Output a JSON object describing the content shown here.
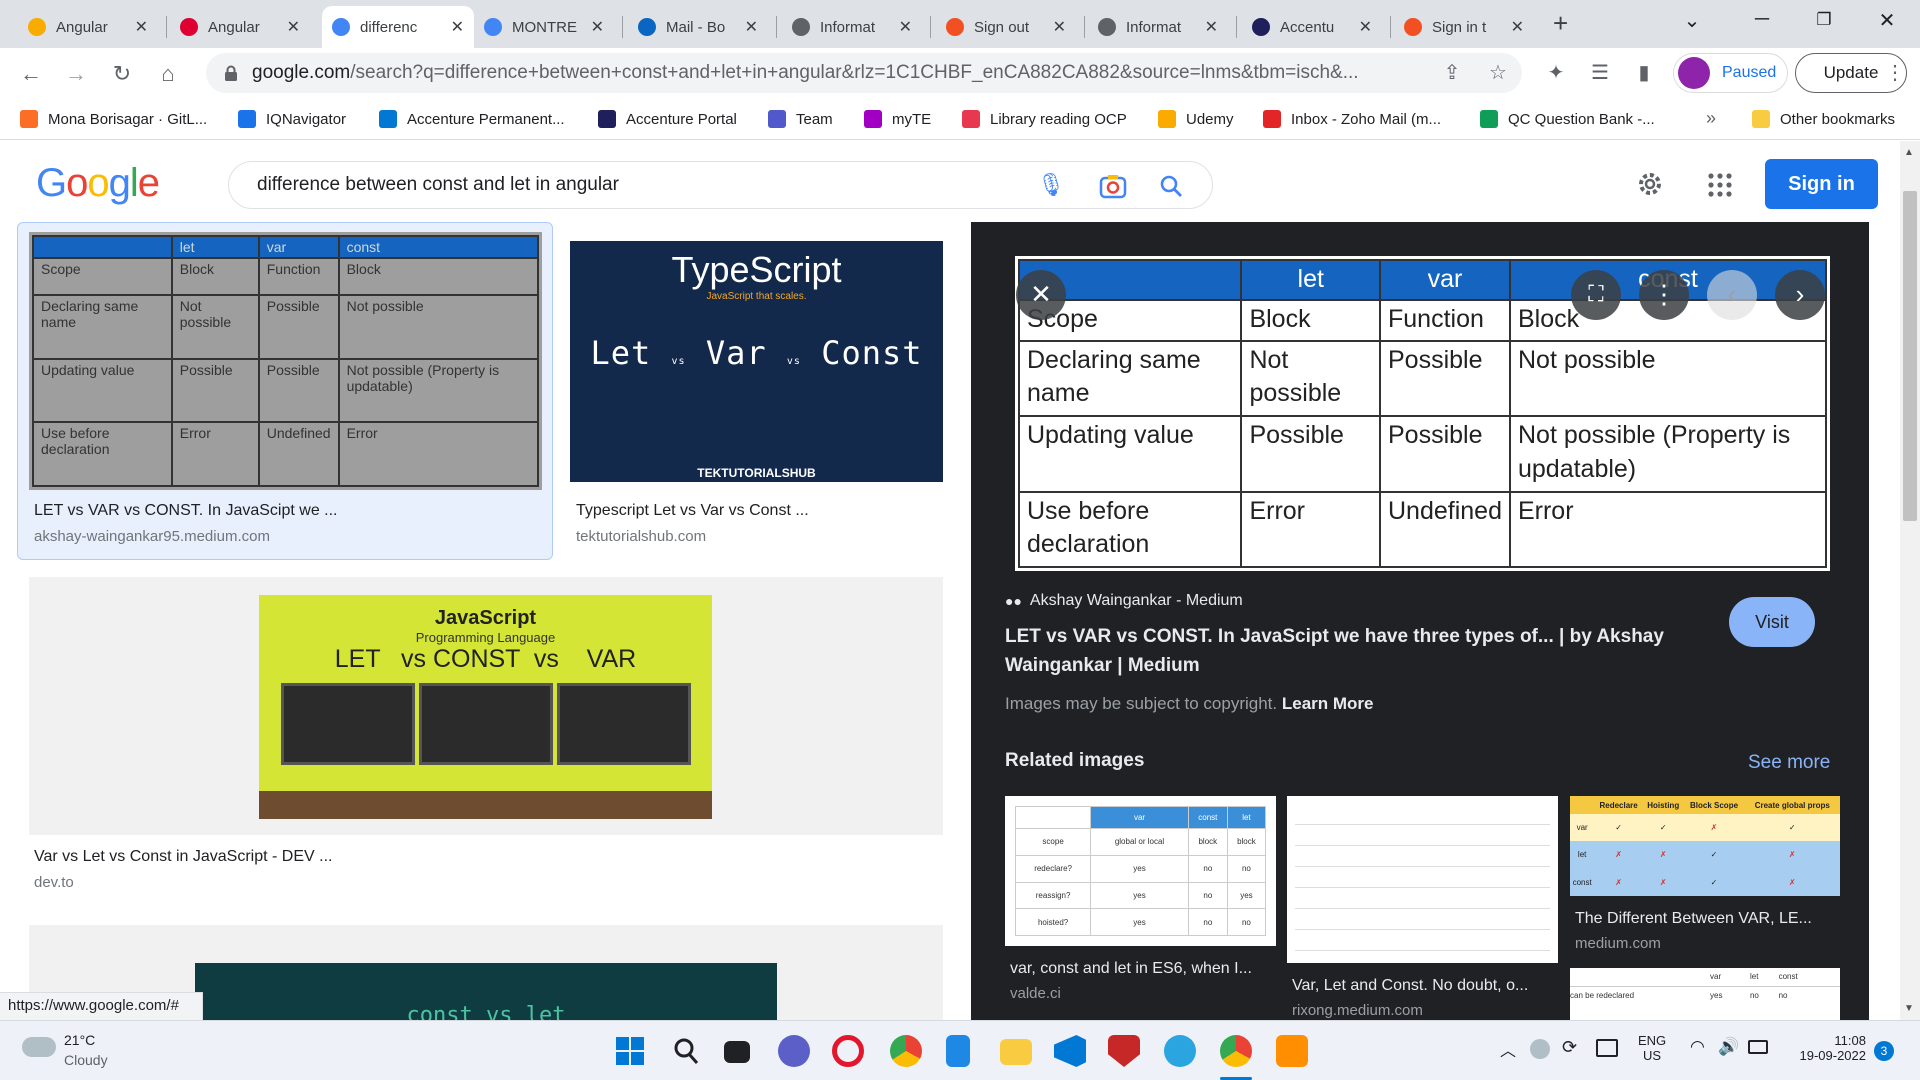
{
  "tabs": [
    {
      "title": "Angular",
      "icon": "angular-tab-icon",
      "color": "#f9ab00"
    },
    {
      "title": "Angular",
      "icon": "angular-logo-icon",
      "color": "#dd0031"
    },
    {
      "title": "differenc",
      "icon": "google-icon",
      "color": "#4285f4",
      "active": true
    },
    {
      "title": "MONTRE",
      "icon": "google-icon",
      "color": "#4285f4"
    },
    {
      "title": "Mail - Bo",
      "icon": "outlook-icon",
      "color": "#0a66c2"
    },
    {
      "title": "Informat",
      "icon": "globe-icon",
      "color": "#5f6368"
    },
    {
      "title": "Sign out",
      "icon": "microsoft-icon",
      "color": "#f25022"
    },
    {
      "title": "Informat",
      "icon": "globe-icon",
      "color": "#5f6368"
    },
    {
      "title": "Accentu",
      "icon": "accenture-icon",
      "color": "#1f1f5b"
    },
    {
      "title": "Sign in t",
      "icon": "microsoft-icon",
      "color": "#f25022"
    }
  ],
  "address": {
    "host": "google.com",
    "rest": "/search?q=difference+between+const+and+let+in+angular&rlz=1C1CHBF_enCA882CA882&source=lnms&tbm=isch&..."
  },
  "profile": {
    "label": "Paused"
  },
  "update_label": "Update",
  "bookmarks": [
    {
      "label": "Mona Borisagar · GitL...",
      "color": "#fc6d26"
    },
    {
      "label": "IQNavigator",
      "color": "#1a73e8"
    },
    {
      "label": "Accenture Permanent...",
      "color": "#0078d4"
    },
    {
      "label": "Accenture Portal",
      "color": "#1f1f5b"
    },
    {
      "label": "Team",
      "color": "#5059c9"
    },
    {
      "label": "myTE",
      "color": "#a100c2"
    },
    {
      "label": "Library reading OCP",
      "color": "#e8384f"
    },
    {
      "label": "Udemy",
      "color": "#f9ab00"
    },
    {
      "label": "Inbox - Zoho Mail (m...",
      "color": "#e42527"
    },
    {
      "label": "QC Question Bank -...",
      "color": "#0f9d58"
    }
  ],
  "bookmarks_more": "»",
  "other_bookmarks": "Other bookmarks",
  "search": {
    "query": "difference between const and let in angular"
  },
  "signin_label": "Sign in",
  "logo": [
    "G",
    "o",
    "o",
    "g",
    "l",
    "e"
  ],
  "table": {
    "headers": [
      "",
      "let",
      "var",
      "const"
    ],
    "rows": [
      [
        "Scope",
        "Block",
        "Function",
        "Block"
      ],
      [
        "Declaring same name",
        "Not possible",
        "Possible",
        "Not possible"
      ],
      [
        "Updating value",
        "Possible",
        "Possible",
        "Not possible (Property is updatable)"
      ],
      [
        "Use before declaration",
        "Error",
        "Undefined",
        "Error"
      ]
    ]
  },
  "results": [
    {
      "title": "LET vs VAR vs CONST. In JavaScipt we ...",
      "source": "akshay-waingankar95.medium.com"
    },
    {
      "title": "Typescript Let vs Var vs Const ...",
      "source": "tektutorialshub.com"
    },
    {
      "title": "Var vs Let vs Const in JavaScript - DEV ...",
      "source": "dev.to"
    }
  ],
  "ts_thumb": {
    "logo": "TypeScript",
    "tagline": "JavaScript that scales.",
    "let": "Let",
    "vs": "vs",
    "var": "Var",
    "const": "Const",
    "footer": "TEKTUTORIALSHUB"
  },
  "js_thumb": {
    "title": "JavaScript",
    "subtitle": "Programming Language",
    "headline": "LET   vs CONST  vs    VAR"
  },
  "bottom_thumb_text": "const vs let",
  "panel": {
    "source": "Akshay Waingankar - Medium",
    "title": "LET vs VAR vs CONST. In JavaScipt we have three types of... | by Akshay Waingankar | Medium",
    "visit_label": "Visit",
    "copyright": "Images may be subject to copyright.",
    "learn_more": "Learn More",
    "related_heading": "Related images",
    "see_more": "See more",
    "related": [
      {
        "title": "var, const and let in ES6, when I...",
        "source": "valde.ci"
      },
      {
        "title": "Var, Let and Const. No doubt, o...",
        "source": "rixong.medium.com"
      },
      {
        "title": "The Different Between VAR, LE...",
        "source": "medium.com"
      }
    ],
    "rel1": {
      "headers": [
        "",
        "var",
        "const",
        "let"
      ],
      "rows": [
        [
          "scope",
          "global or local",
          "block",
          "block"
        ],
        [
          "redeclare?",
          "yes",
          "no",
          "no"
        ],
        [
          "reassign?",
          "yes",
          "no",
          "yes"
        ],
        [
          "hoisted?",
          "yes",
          "no",
          "no"
        ]
      ]
    },
    "rel3": {
      "headers": [
        "",
        "Redeclare",
        "Hoisting",
        "Block Scope",
        "Create global props"
      ],
      "rows": [
        [
          "var",
          "✓",
          "✓",
          "✗",
          "✓"
        ],
        [
          "let",
          "✗",
          "✗",
          "✓",
          "✗"
        ],
        [
          "const",
          "✗",
          "✗",
          "✓",
          "✗"
        ]
      ]
    },
    "rel4": {
      "headers": [
        "",
        "var",
        "let",
        "const"
      ],
      "rows": [
        [
          "can be redeclared",
          "yes",
          "no",
          "no"
        ]
      ]
    }
  },
  "status_url": "https://www.google.com/#",
  "weather": {
    "temp": "21°C",
    "desc": "Cloudy"
  },
  "tray": {
    "lang": "ENG",
    "region": "US",
    "time": "11:08",
    "date": "19-09-2022",
    "notif": "3"
  }
}
